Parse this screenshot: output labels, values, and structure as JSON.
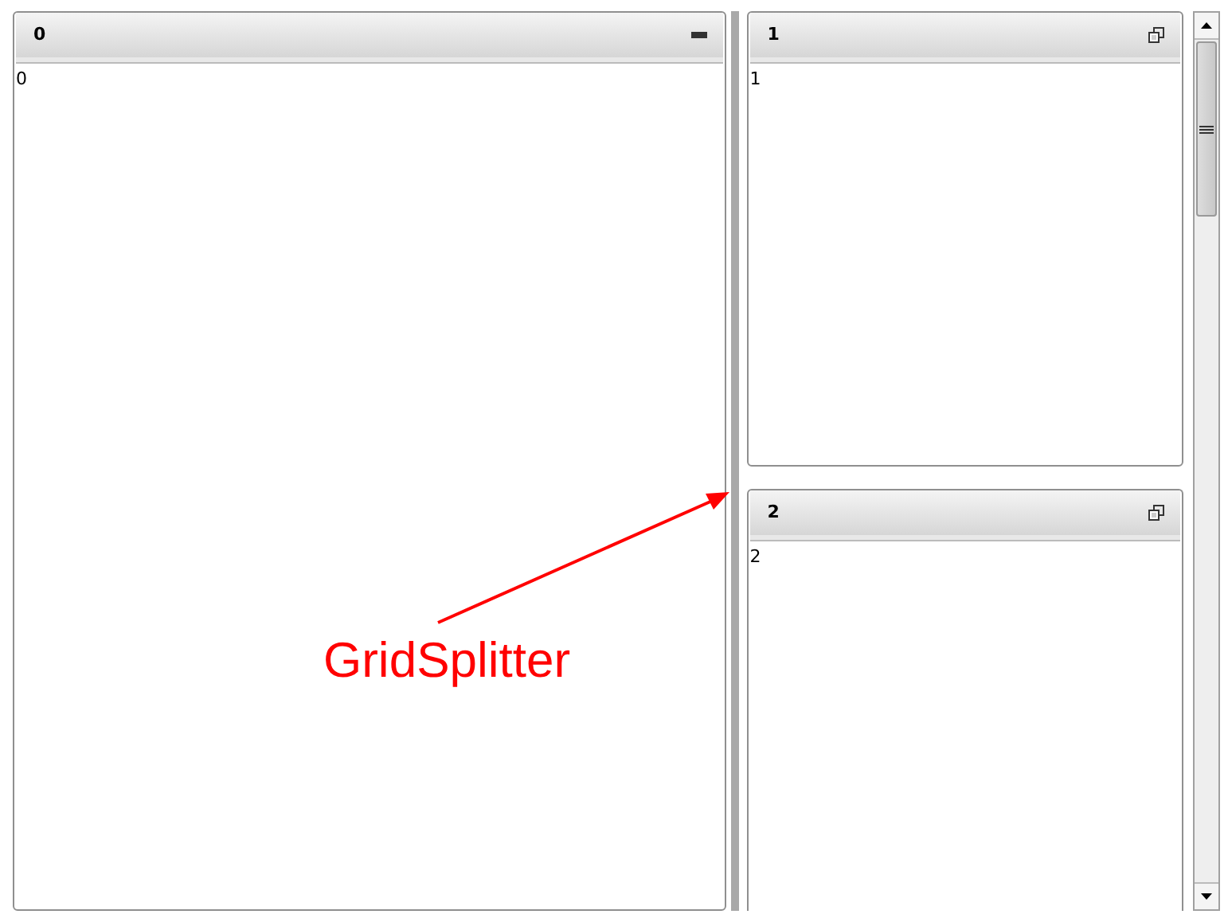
{
  "panels": [
    {
      "title": "0",
      "content": "0",
      "kind": "minimize"
    },
    {
      "title": "1",
      "content": "1",
      "kind": "restore"
    },
    {
      "title": "2",
      "content": "2",
      "kind": "restore"
    }
  ],
  "annotation": {
    "label": "GridSplitter"
  }
}
